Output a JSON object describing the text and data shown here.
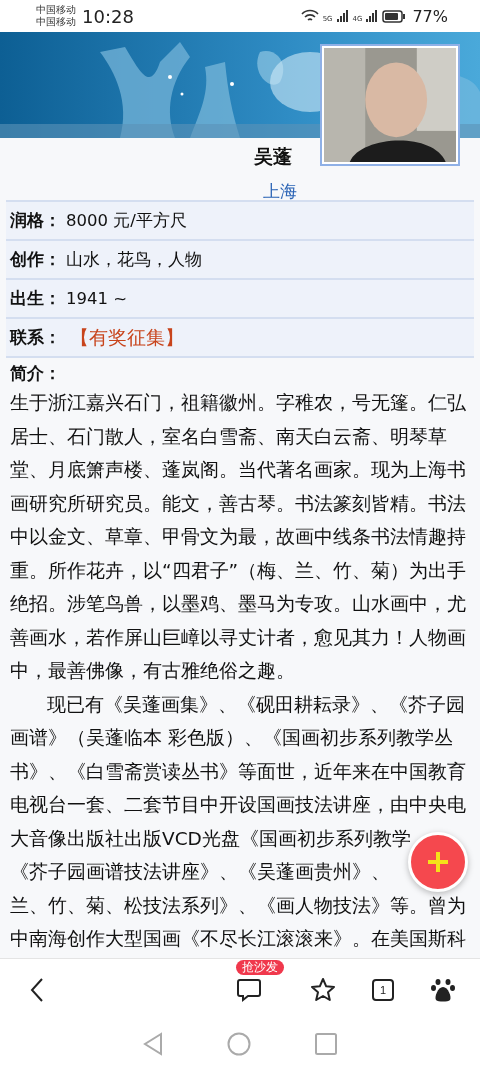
{
  "status_bar": {
    "carriers": [
      "中国移动",
      "中国移动"
    ],
    "time": "10:28",
    "network_labels": [
      "5G",
      "4G"
    ],
    "battery": "77%"
  },
  "profile": {
    "name": "吴蓬",
    "location": "上海"
  },
  "details": [
    {
      "label": "润格：",
      "value": "8000 元/平方尺",
      "kind": "text"
    },
    {
      "label": "创作：",
      "value": "山水，花鸟，人物",
      "kind": "text"
    },
    {
      "label": "出生：",
      "value": "1941 ~",
      "kind": "text"
    },
    {
      "label": "联系：",
      "value": "【有奖征集】",
      "kind": "link"
    }
  ],
  "intro": {
    "label": "简介：",
    "paragraphs": [
      {
        "indented": false,
        "lines": [
          "生于浙江嘉兴石门，祖籍徽州。字稚农，号无篷。仁弘",
          "居士、石门散人，室名白雪斋、南天白云斋、明琴草",
          "堂、月底箫声楼、蓬岚阁。当代著名画家。现为上海书",
          "画研究所研究员。能文，善古琴。书法篆刻皆精。书法",
          "中以金文、草章、甲骨文为最，故画中线条书法情趣持",
          "重。所作花卉，以“四君子”（梅、兰、竹、菊）为出手",
          "绝招。涉笔鸟兽，以墨鸡、墨马为专攻。山水画中，尤",
          "善画水，若作屏山巨嶂以寻丈计者，愈见其力！人物画",
          "中，最善佛像，有古雅绝俗之趣。"
        ]
      },
      {
        "indented": true,
        "lines": [
          "现已有《吴蓬画集》、《砚田耕耘录》、《芥子园",
          "画谱》（吴蓬临本 彩色版）、《国画初步系列教学丛",
          "书》、《白雪斋赏读丛书》等面世，近年来在中国教育",
          "电视台一套、二套节目中开设国画技法讲座，由中央电",
          "大音像出版社出版VCD光盘《国画初步系列教学",
          "《芥子园画谱技法讲座》、《吴蓬画贵州》、",
          "兰、竹、菊、松技法系列》、《画人物技法》等。曾为",
          "中南海创作大型国画《不尽长江滚滚来》。在美国斯科"
        ]
      }
    ]
  },
  "toolbar": {
    "comment_badge": "抢沙发",
    "tab_count": "1"
  }
}
